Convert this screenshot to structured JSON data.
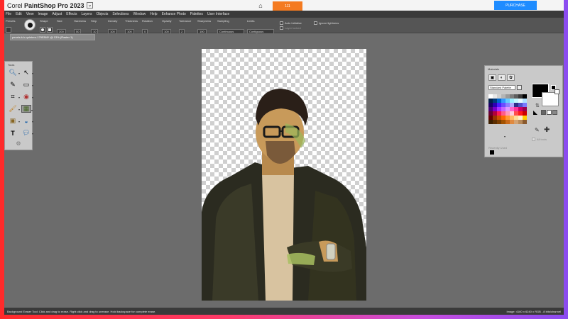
{
  "titlebar": {
    "brand_small": "Corel",
    "brand_title": "PaintShop Pro 2023",
    "center_button_label": "111",
    "purchase_label": "PURCHASE"
  },
  "menu": [
    "File",
    "Edit",
    "View",
    "Image",
    "Adjust",
    "Effects",
    "Layers",
    "Objects",
    "Selections",
    "Window",
    "Help",
    "Enhance Photo",
    "Palettes",
    "User Interface"
  ],
  "options": {
    "presets_label": "Presets",
    "shape_label": "Shape",
    "size_label": "Size",
    "size_value": "200",
    "hardness_label": "Hardness",
    "hardness_value": "50",
    "step_label": "Step",
    "step_value": "10",
    "density_label": "Density",
    "density_value": "100",
    "thickness_label": "Thickness",
    "thickness_value": "100",
    "rotation_label": "Rotation",
    "rotation_value": "0",
    "opacity_label": "Opacity",
    "opacity_value": "100",
    "tolerance_label": "Tolerance",
    "tolerance_value": "2",
    "sharpness_label": "Sharpness",
    "sharpness_value": "100",
    "sampling_label": "Sampling",
    "sampling_value": "Continuous",
    "limits_label": "Limits",
    "limits_value": "Contiguous",
    "auto_label": "Auto Initialize",
    "layer_locked_label": "Layer locked",
    "ignore_label": "Ignore lightness"
  },
  "document_tab": "pexels-k-k-quintero-1795360* @ 13% (Raster 1)",
  "tools_title": "Tools",
  "materials": {
    "title": "Materials",
    "palette_select": "Standard Palette",
    "all_tools_label": "All tools",
    "recently_used_label": "Recently Used"
  },
  "status": {
    "left": "Background Eraser Tool: Click and drag to erase. Right click and drag to unerase. Hold backspace for complete erase.",
    "right": "Image: 4160 x 6240 x RGB - 8 bits/channel"
  },
  "swatch_colors": [
    "#ffffff",
    "#e8e8e8",
    "#cfcfcf",
    "#b5b5b5",
    "#9a9a9a",
    "#7d7d7d",
    "#5e5e5e",
    "#3a3a3a",
    "#000000",
    "#00204a",
    "#003a7a",
    "#0066cc",
    "#3399ff",
    "#66ccff",
    "#99eeff",
    "#c4f6ff",
    "#e8fbff",
    "#b0e0ff",
    "#1a0066",
    "#2d00b3",
    "#4b1aff",
    "#6b4cff",
    "#8e7dff",
    "#b3a8ff",
    "#2e2e8a",
    "#5050c8",
    "#7a7aff",
    "#4a007a",
    "#7a00cc",
    "#a633ff",
    "#c466ff",
    "#e099ff",
    "#ff66cc",
    "#ff3399",
    "#cc0066",
    "#99004d",
    "#660033",
    "#b3003c",
    "#ff1a53",
    "#ff5c8a",
    "#ff99b8",
    "#ffccdd",
    "#ff4d4d",
    "#ff1a1a",
    "#cc0000",
    "#660000",
    "#993300",
    "#cc5200",
    "#ff6600",
    "#ff9933",
    "#ffbb66",
    "#ffdd99",
    "#fff0cc",
    "#ffcc00",
    "#3d1f00",
    "#5c2e00",
    "#7a3d00",
    "#a35200",
    "#c96a1a",
    "#e08a40",
    "#d4a373",
    "#b88a5a",
    "#8a5a2e"
  ]
}
